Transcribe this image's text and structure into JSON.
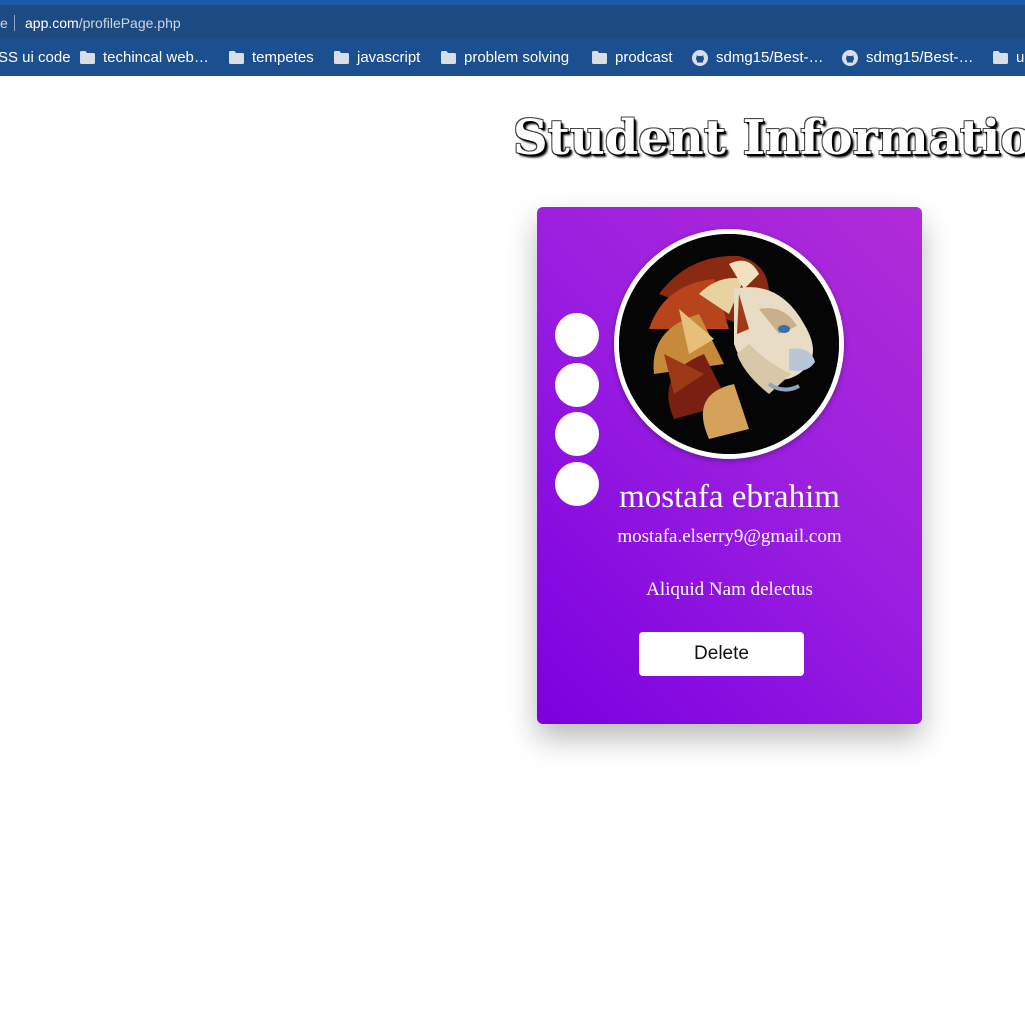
{
  "browser": {
    "tab_prefix": "e",
    "url_host": "app.com",
    "url_path": "/profilePage.php",
    "bookmarks": [
      {
        "label": "SS ui code",
        "icon": "none"
      },
      {
        "label": "techincal web…",
        "icon": "folder-icon"
      },
      {
        "label": "tempetes",
        "icon": "folder-icon"
      },
      {
        "label": "javascript",
        "icon": "folder-icon"
      },
      {
        "label": "problem solving",
        "icon": "folder-icon"
      },
      {
        "label": "prodcast",
        "icon": "folder-icon"
      },
      {
        "label": "sdmg15/Best-…",
        "icon": "github-icon"
      },
      {
        "label": "sdmg15/Best-…",
        "icon": "github-icon"
      },
      {
        "label": "u",
        "icon": "folder-icon"
      }
    ]
  },
  "page": {
    "title": "Student Informatio"
  },
  "profile": {
    "name": "mostafa ebrahim",
    "email": "mostafa.elserry9@gmail.com",
    "bio": "Aliquid Nam delectus",
    "delete_label": "Delete",
    "avatar_icon": "lion-avatar",
    "social_icons": [
      "social-link-1",
      "social-link-2",
      "social-link-3",
      "social-link-4"
    ]
  },
  "colors": {
    "card_gradient_start": "#7b00e0",
    "card_gradient_end": "#b02cd6",
    "browser_bar": "#1b4f8f"
  }
}
